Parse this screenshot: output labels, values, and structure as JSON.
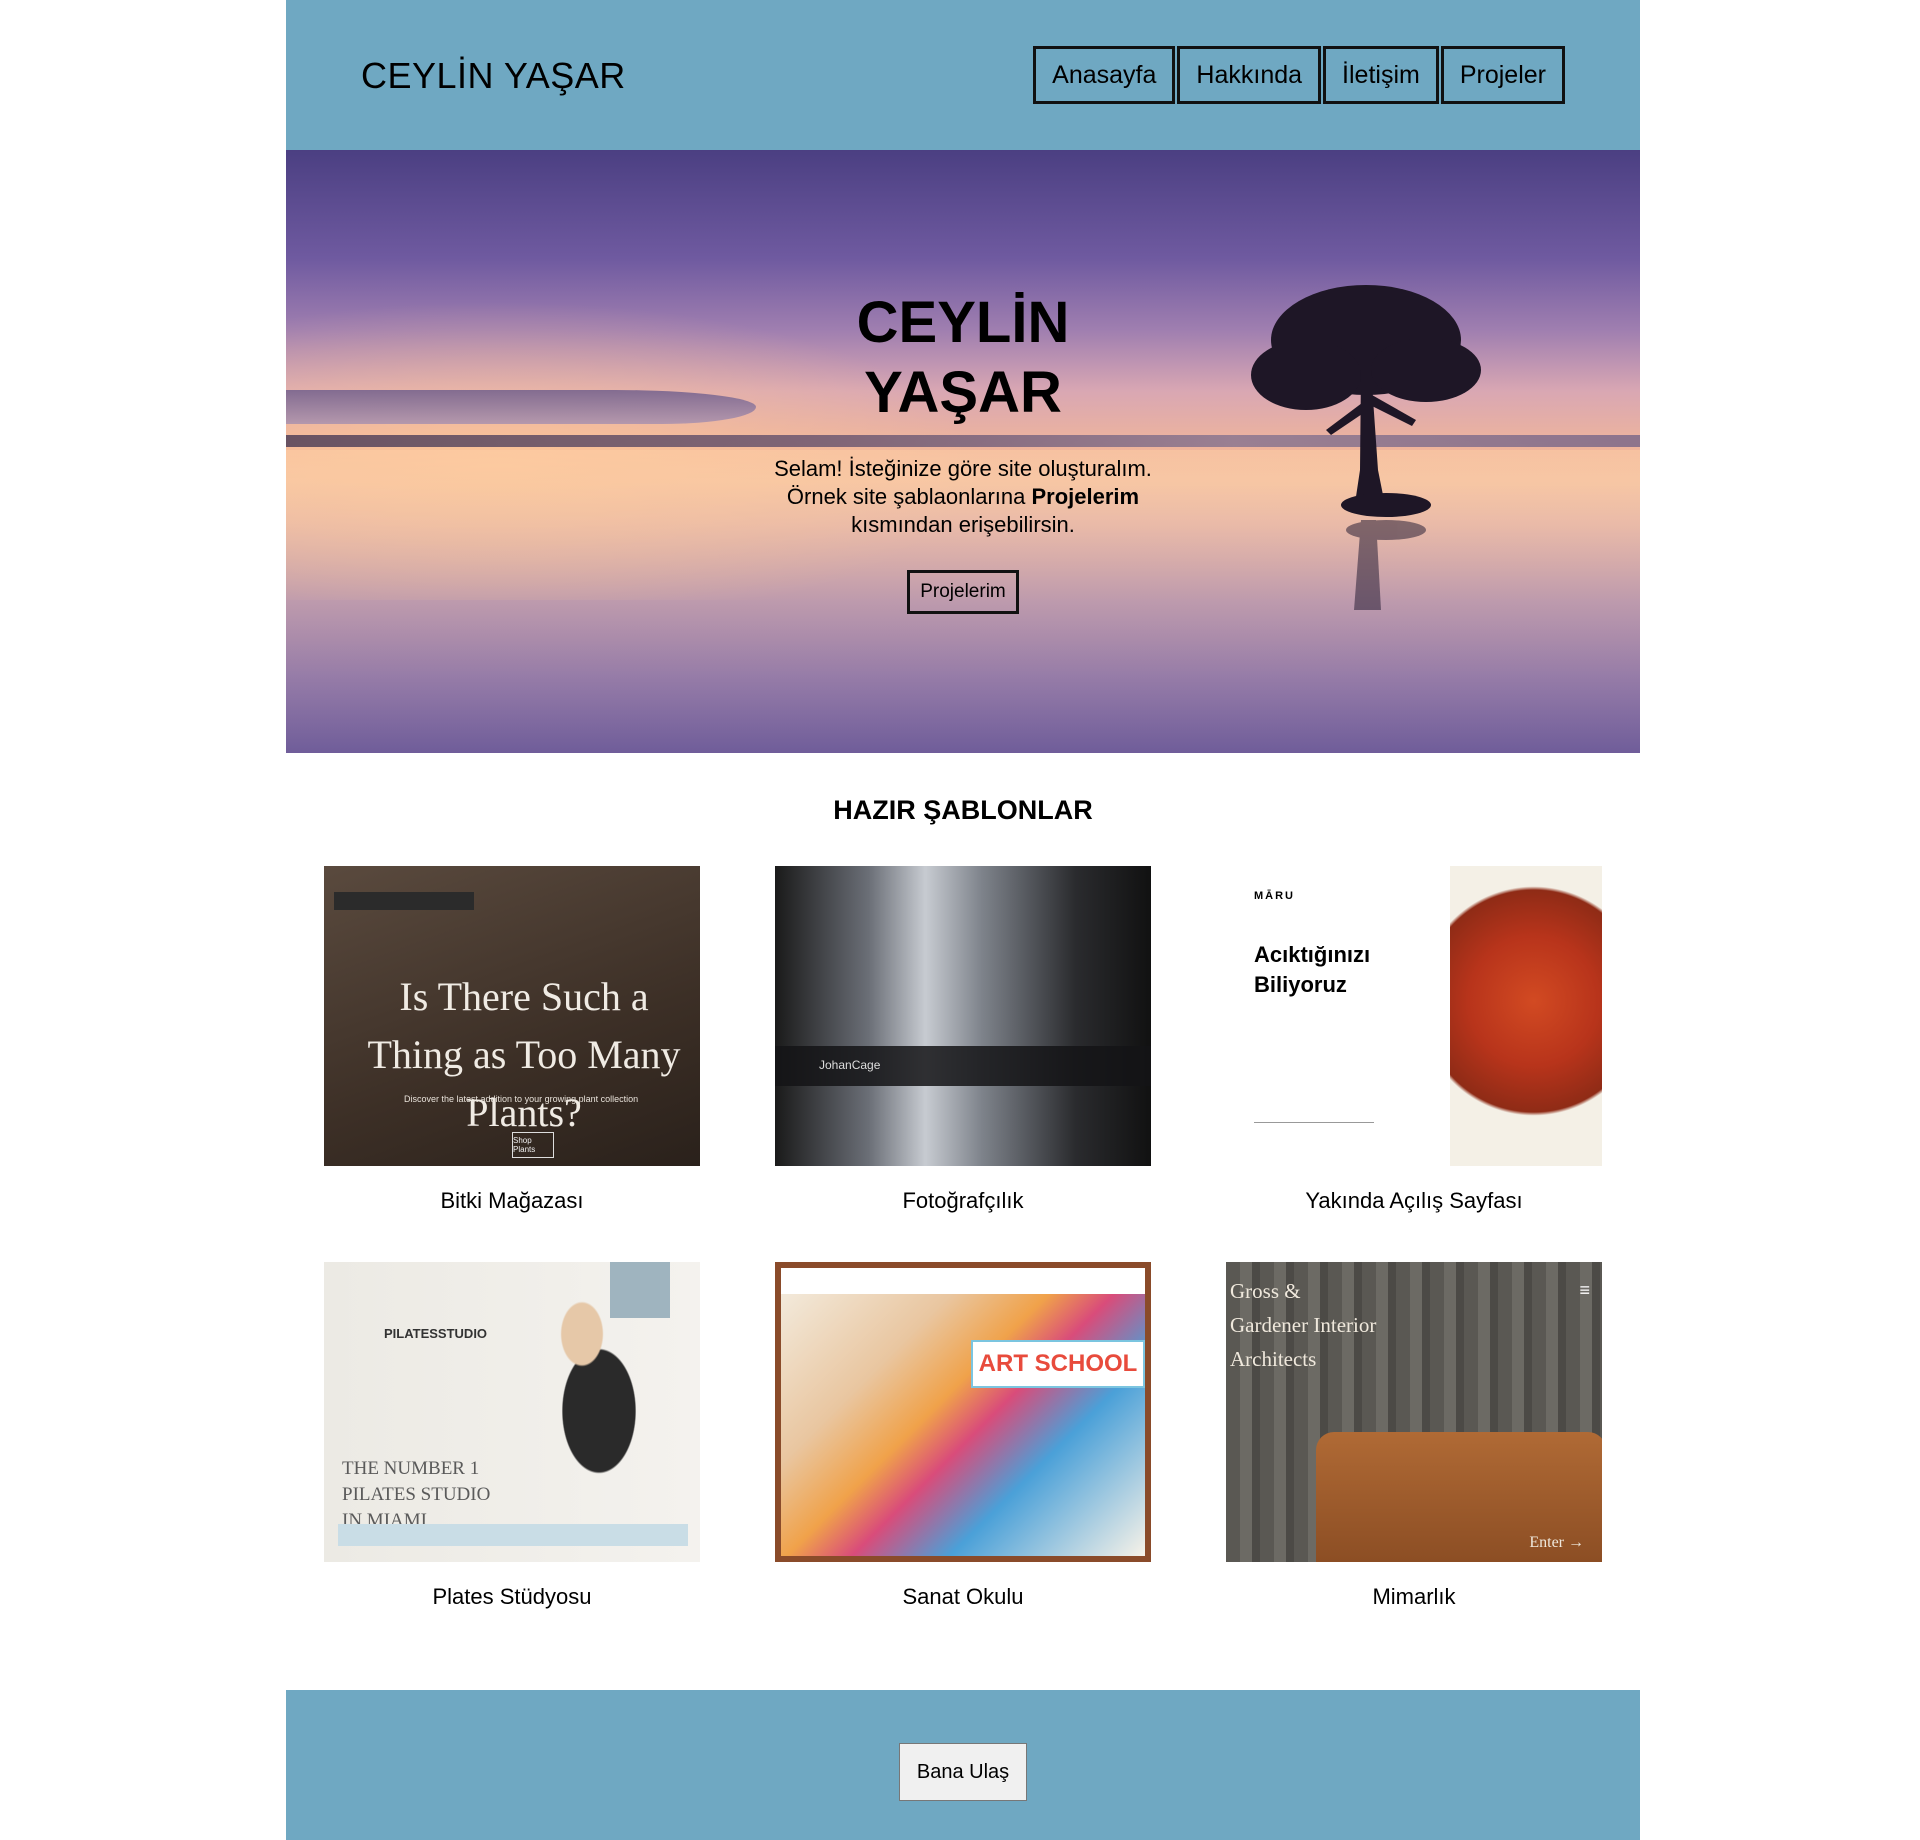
{
  "header": {
    "brand": "CEYLİN YAŞAR",
    "nav": [
      "Anasayfa",
      "Hakkında",
      "İletişim",
      "Projeler"
    ]
  },
  "hero": {
    "title_line1": "CEYLİN",
    "title_line2": "YAŞAR",
    "text_line1": "Selam! İsteğinize göre site oluşturalım.",
    "text_line2_pre": "Örnek site şablaonlarına ",
    "text_line2_bold": "Projelerim",
    "text_line3": "kısmından erişebilirsin.",
    "button": "Projelerim"
  },
  "templates": {
    "title": "HAZIR ŞABLONLAR",
    "items": [
      {
        "caption": "Bitki Mağazası",
        "preview_heading": "Is There Such a Thing as Too Many Plants?",
        "preview_sub": "Discover the latest addition to your growing plant collection",
        "preview_button": "Shop Plants"
      },
      {
        "caption": "Fotoğrafçılık",
        "preview_heading": "JohanCage"
      },
      {
        "caption": "Yakında Açılış Sayfası",
        "preview_logo": "MĀRU",
        "preview_heading": "Acıktığınızı Biliyoruz"
      },
      {
        "caption": "Plates Stüdyosu",
        "preview_logo": "PILATESSTUDIO",
        "preview_heading": "THE NUMBER 1 PILATES STUDIO IN MIAMI"
      },
      {
        "caption": "Sanat Okulu",
        "preview_heading": "ART SCHOOL"
      },
      {
        "caption": "Mimarlık",
        "preview_heading": "Gross & Gardener Interior Architects",
        "preview_button": "Enter →"
      }
    ]
  },
  "footer": {
    "button": "Bana Ulaş"
  },
  "colors": {
    "header_bg": "#6fa8c2",
    "footer_bg": "#6fa8c2"
  }
}
